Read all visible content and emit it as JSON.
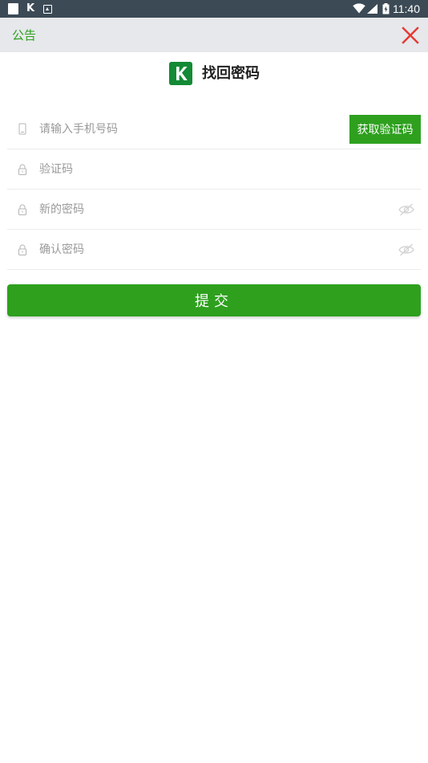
{
  "status_bar": {
    "time": "11:40",
    "icons": [
      "square-notification-icon",
      "k-app-icon",
      "image-notification-icon",
      "wifi-icon",
      "signal-icon",
      "battery-icon"
    ]
  },
  "topbar": {
    "notice_label": "公告",
    "close_icon": "close-icon"
  },
  "header": {
    "logo_letter": "K",
    "title": "找回密码"
  },
  "form": {
    "phone": {
      "placeholder": "请输入手机号码",
      "icon": "phone-icon"
    },
    "get_code_label": "获取验证码",
    "code": {
      "placeholder": "验证码",
      "icon": "lock-icon"
    },
    "new_password": {
      "placeholder": "新的密码",
      "icon": "lock-icon",
      "toggle_icon": "eye-hidden-icon"
    },
    "confirm_password": {
      "placeholder": "确认密码",
      "icon": "lock-icon",
      "toggle_icon": "eye-hidden-icon"
    },
    "submit_label": "提交"
  },
  "colors": {
    "accent": "#2ea01e",
    "logo_bg": "#138a35",
    "status_bar": "#3c4a55",
    "topbar_bg": "#e6e8eb",
    "close_red": "#e53935"
  }
}
